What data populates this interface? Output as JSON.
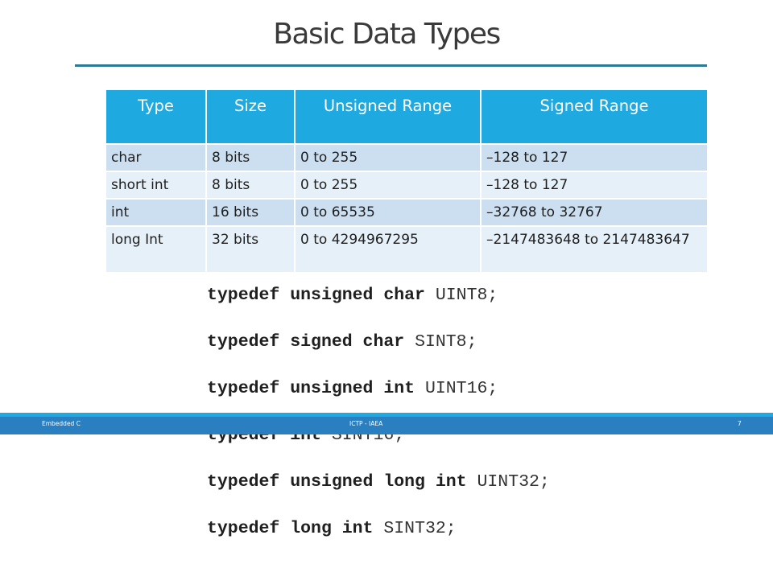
{
  "slide": {
    "title": "Basic Data Types",
    "accent_color": "#1ea9e1",
    "rule_color": "#2b7a96"
  },
  "table": {
    "headers": [
      "Type",
      "Size",
      "Unsigned Range",
      "Signed Range"
    ],
    "rows": [
      [
        "char",
        "8 bits",
        "0 to 255",
        "–128 to 127"
      ],
      [
        "short int",
        "8 bits",
        "0 to 255",
        "–128 to 127"
      ],
      [
        "int",
        "16 bits",
        "0 to 65535",
        "–32768 to 32767"
      ],
      [
        "long Int",
        "32 bits",
        "0 to 4294967295",
        "–2147483648 to 2147483647"
      ]
    ]
  },
  "code": {
    "lines": [
      {
        "keyword": "typedef",
        "type": "unsigned char",
        "name": "UINT8;"
      },
      {
        "keyword": "typedef",
        "type": "signed char",
        "name": "SINT8;"
      },
      {
        "keyword": "typedef",
        "type": "unsigned int",
        "name": "UINT16;"
      },
      {
        "keyword": "typedef",
        "type": "int",
        "name": "SINT16;"
      },
      {
        "keyword": "typedef",
        "type": "unsigned long int",
        "name": "UINT32;"
      },
      {
        "keyword": "typedef",
        "type": "long int",
        "name": "SINT32;"
      }
    ]
  },
  "footer": {
    "left": "Embedded C",
    "center": "ICTP - IAEA",
    "page_number": "7"
  }
}
